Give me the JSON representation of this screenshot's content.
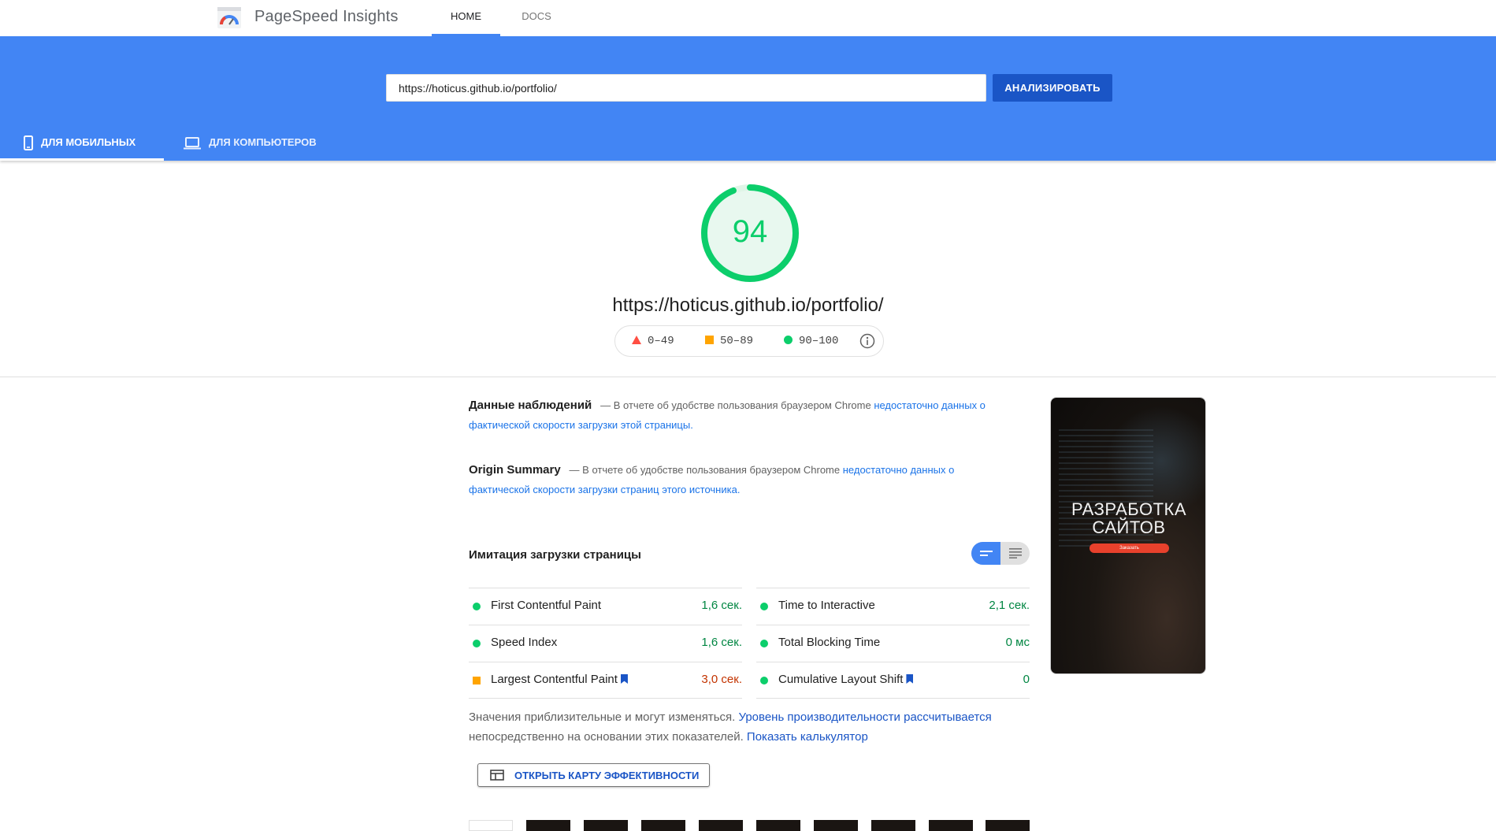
{
  "header": {
    "app_title": "PageSpeed Insights",
    "logo_icon": "pagespeed-gauge-icon",
    "nav": [
      {
        "label": "HOME",
        "active": true
      },
      {
        "label": "DOCS",
        "active": false
      }
    ]
  },
  "analyze": {
    "url_value": "https://hoticus.github.io/portfolio/",
    "button_label": "АНАЛИЗИРОВАТЬ"
  },
  "device_tabs": [
    {
      "label": "ДЛЯ МОБИЛЬНЫХ",
      "icon": "smartphone-icon",
      "active": true
    },
    {
      "label": "ДЛЯ КОМПЬЮТЕРОВ",
      "icon": "laptop-icon",
      "active": false
    }
  ],
  "score": {
    "value": 94,
    "value_text": "94",
    "url": "https://hoticus.github.io/portfolio/",
    "legend": [
      {
        "range": "0–49",
        "shape": "triangle",
        "color": "#ff4e42"
      },
      {
        "range": "50–89",
        "shape": "square",
        "color": "#ffa400"
      },
      {
        "range": "90–100",
        "shape": "circle",
        "color": "#0cce6b"
      }
    ]
  },
  "field_data": {
    "title": "Данные наблюдений",
    "text": "— В отчете об удобстве пользования браузером Chrome",
    "link": "недостаточно данных о фактической скорости загрузки этой страницы."
  },
  "origin_summary": {
    "title": "Origin Summary",
    "text": "— В отчете об удобстве пользования браузером Chrome",
    "link": "недостаточно данных о фактической скорости загрузки страниц этого источника."
  },
  "lab": {
    "title": "Имитация загрузки страницы",
    "metrics": [
      {
        "name": "First Contentful Paint",
        "value": "1,6 сек.",
        "status": "good",
        "bookmark": false
      },
      {
        "name": "Time to Interactive",
        "value": "2,1 сек.",
        "status": "good",
        "bookmark": false
      },
      {
        "name": "Speed Index",
        "value": "1,6 сек.",
        "status": "good",
        "bookmark": false
      },
      {
        "name": "Total Blocking Time",
        "value": "0 мс",
        "status": "good",
        "bookmark": false
      },
      {
        "name": "Largest Contentful Paint",
        "value": "3,0 сек.",
        "status": "average",
        "bookmark": true
      },
      {
        "name": "Cumulative Layout Shift",
        "value": "0",
        "status": "good",
        "bookmark": true
      }
    ],
    "note_text_1": "Значения приблизительные и могут изменяться.",
    "note_link_1": "Уровень производительности рассчитывается",
    "note_text_2": "непосредственно на основании этих показателей.",
    "note_link_2": "Показать калькулятор",
    "treemap_button": "ОТКРЫТЬ КАРТУ ЭФФЕКТИВНОСТИ"
  },
  "preview": {
    "headline": "РАЗРАБОТКА САЙТОВ",
    "button": "Заказать"
  },
  "colors": {
    "brand_blue": "#4285f4",
    "good": "#0cce6b",
    "average": "#ffa400",
    "poor": "#ff4e42"
  }
}
